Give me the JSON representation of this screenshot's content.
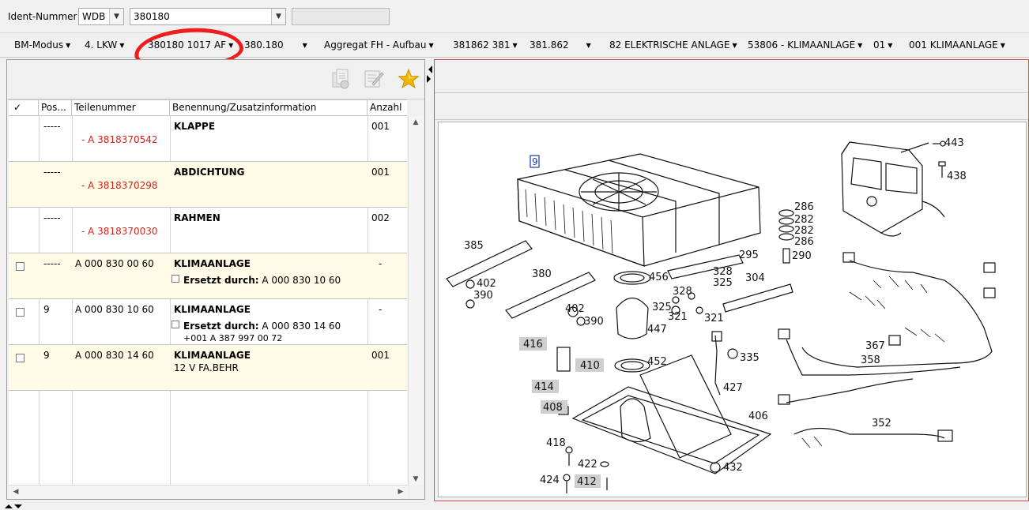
{
  "ident": {
    "label": "Ident-Nummer",
    "prefix": "WDB",
    "number": "380180",
    "extra": ""
  },
  "breadcrumb": [
    {
      "label": "BM-Modus",
      "caret": "▼"
    },
    {
      "label": "4. LKW",
      "caret": "▼"
    },
    {
      "label": "380180 1017 AF",
      "caret": "▼"
    },
    {
      "label": "380.180",
      "caret": "▼"
    },
    {
      "label": "Aggregat FH - Aufbau",
      "caret": "▼"
    },
    {
      "label": "381862 381",
      "caret": "▼"
    },
    {
      "label": "381.862",
      "caret": "▼"
    },
    {
      "label": "82 ELEKTRISCHE ANLAGE",
      "caret": "▼"
    },
    {
      "label": "53806 - KLIMAANLAGE",
      "caret": "▼"
    },
    {
      "label": "01",
      "caret": "▼"
    },
    {
      "label": "001 KLIMAANLAGE",
      "caret": "▼"
    }
  ],
  "toolbar": {
    "copy_icon": "copy-doc-icon",
    "edit_icon": "edit-notes-icon",
    "favorite_icon": "star-icon",
    "accent": "#f2b705"
  },
  "table": {
    "headers": {
      "check": "✓",
      "pos": "Pos...",
      "part": "Teilenummer",
      "name": "Benennung/Zusatzinformation",
      "qty": "Anzahl"
    },
    "rows": [
      {
        "pos": "-----",
        "part": "- A 3818370542",
        "name": "KLAPPE",
        "qty": "001"
      },
      {
        "pos": "-----",
        "part": "- A 3818370298",
        "name": "ABDICHTUNG",
        "qty": "001"
      },
      {
        "pos": "-----",
        "part": "- A 3818370030",
        "name": "RAHMEN",
        "qty": "002"
      },
      {
        "pos": "-----",
        "part": "A 000 830 00 60",
        "name": "KLIMAANLAGE",
        "qty": "-",
        "sub_label": "Ersetzt durch:",
        "sub_value": "A 000 830 10 60"
      },
      {
        "pos": "9",
        "part": "A 000 830 10 60",
        "name": "KLIMAANLAGE",
        "qty": "-",
        "sub_label": "Ersetzt durch:",
        "sub_value": "A 000 830 14 60",
        "sub2": "+001 A 387 997 00 72"
      },
      {
        "pos": "9",
        "part": "A 000 830 14 60",
        "name": "KLIMAANLAGE",
        "qty": "001",
        "sub_plain": "12 V FA.BEHR"
      }
    ]
  },
  "drawing": {
    "labels": {
      "l9": "9",
      "l443": "443",
      "l438": "438",
      "l286a": "286",
      "l282a": "282",
      "l282b": "282",
      "l286b": "286",
      "l290": "290",
      "l385": "385",
      "l402a": "402",
      "l390a": "390",
      "l380": "380",
      "l402b": "402",
      "l390b": "390",
      "l456": "456",
      "l295": "295",
      "l328a": "328",
      "l325a": "325",
      "l328b": "328",
      "l325b": "325",
      "l321a": "321",
      "l321b": "321",
      "l304": "304",
      "l447": "447",
      "l416": "416",
      "l410": "410",
      "l452": "452",
      "l335": "335",
      "l414": "414",
      "l427": "427",
      "l408": "408",
      "l406": "406",
      "l418": "418",
      "l422": "422",
      "l432": "432",
      "l424": "424",
      "l412": "412",
      "l367": "367",
      "l358": "358",
      "l352": "352"
    }
  }
}
